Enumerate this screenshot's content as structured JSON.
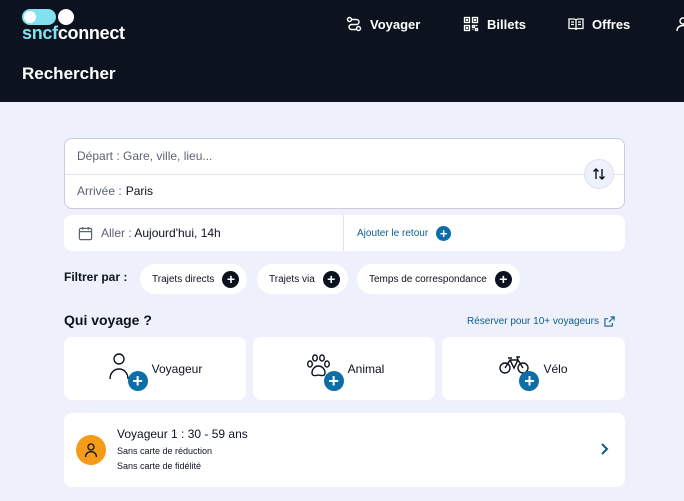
{
  "header": {
    "logo": {
      "part1": "sncf",
      "part2": "connect"
    },
    "nav": [
      {
        "label": "Voyager",
        "icon": "route-icon"
      },
      {
        "label": "Billets",
        "icon": "qr-code-icon"
      },
      {
        "label": "Offres",
        "icon": "book-icon"
      }
    ],
    "page_title": "Rechercher"
  },
  "search": {
    "depart_placeholder": "Départ : Gare, ville, lieu...",
    "arrivee_label": "Arrivée :",
    "arrivee_value": "Paris",
    "aller_label": "Aller :",
    "aller_value": "Aujourd'hui, 14h",
    "retour_label": "Ajouter le retour"
  },
  "filters": {
    "label": "Filtrer par :",
    "chips": [
      "Trajets directs",
      "Trajets via",
      "Temps de correspondance"
    ]
  },
  "who": {
    "title": "Qui voyage ?",
    "reserve_link": "Réserver pour 10+ voyageurs",
    "types": [
      "Voyageur",
      "Animal",
      "Vélo"
    ]
  },
  "traveler": {
    "name": "Voyageur 1 : 30 - 59 ans",
    "reduction": "Sans carte de réduction",
    "fidelite": "Sans carte de fidélité"
  },
  "colors": {
    "header_bg": "#0c131f",
    "page_bg": "#eef0fb",
    "accent_blue": "#0b6ea8",
    "logo_cyan": "#82e0ef",
    "avatar_orange": "#f49b18"
  }
}
